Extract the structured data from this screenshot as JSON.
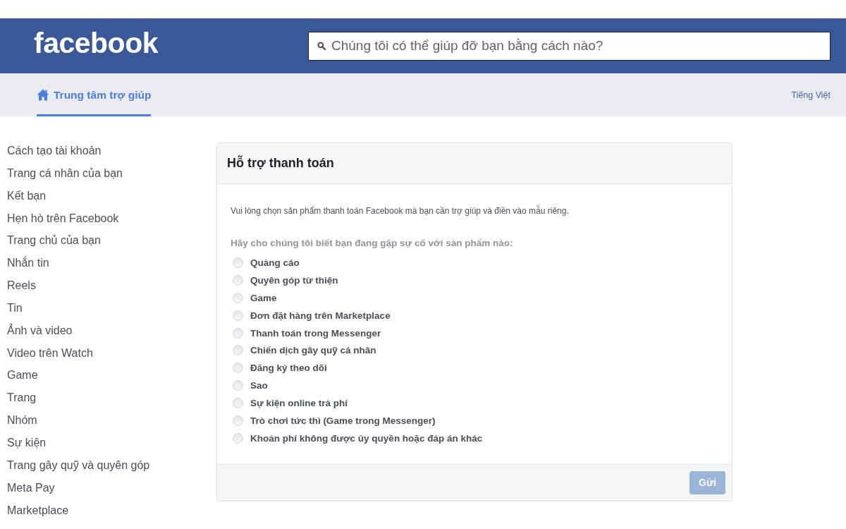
{
  "header": {
    "logo": "facebook",
    "search": {
      "placeholder": "Chúng tôi có thể giúp đỡ bạn bằng cách nào?"
    }
  },
  "nav": {
    "tabs": [
      {
        "label": "Trung tâm trợ giúp",
        "selected": true
      }
    ],
    "language": "Tiếng Việt"
  },
  "sidebar": {
    "items": [
      "Cách tạo tài khoản",
      "Trang cá nhân của bạn",
      "Kết bạn",
      "Hẹn hò trên Facebook",
      "Trang chủ của bạn",
      "Nhắn tin",
      "Reels",
      "Tin",
      "Ảnh và video",
      "Video trên Watch",
      "Game",
      "Trang",
      "Nhóm",
      "Sự kiện",
      "Trang gây quỹ và quyên góp",
      "Meta Pay",
      "Marketplace"
    ]
  },
  "form": {
    "title": "Hỗ trợ thanh toán",
    "description": "Vui lòng chọn sản phẩm thanh toán Facebook mà bạn cần trợ giúp và điền vào mẫu riêng.",
    "question": "Hãy cho chúng tôi biết bạn đang gặp sự cố với sản phẩm nào:",
    "options": [
      {
        "label": "Quảng cáo",
        "selected": false
      },
      {
        "label": "Quyên góp từ thiện",
        "selected": false
      },
      {
        "label": "Game",
        "selected": false
      },
      {
        "label": "Đơn đặt hàng trên Marketplace",
        "selected": false
      },
      {
        "label": "Thanh toán trong Messenger",
        "selected": false
      },
      {
        "label": "Chiến dịch gây quỹ cá nhân",
        "selected": false
      },
      {
        "label": "Đăng ký theo dõi",
        "selected": false
      },
      {
        "label": "Sao",
        "selected": false
      },
      {
        "label": "Sự kiện online trả phí",
        "selected": false
      },
      {
        "label": "Trò chơi tức thì (Game trong Messenger)",
        "selected": false
      },
      {
        "label": "Khoản phí không được ủy quyền hoặc đáp án khác",
        "selected": false
      }
    ],
    "submit": {
      "label": "Gửi",
      "disabled": true
    }
  }
}
